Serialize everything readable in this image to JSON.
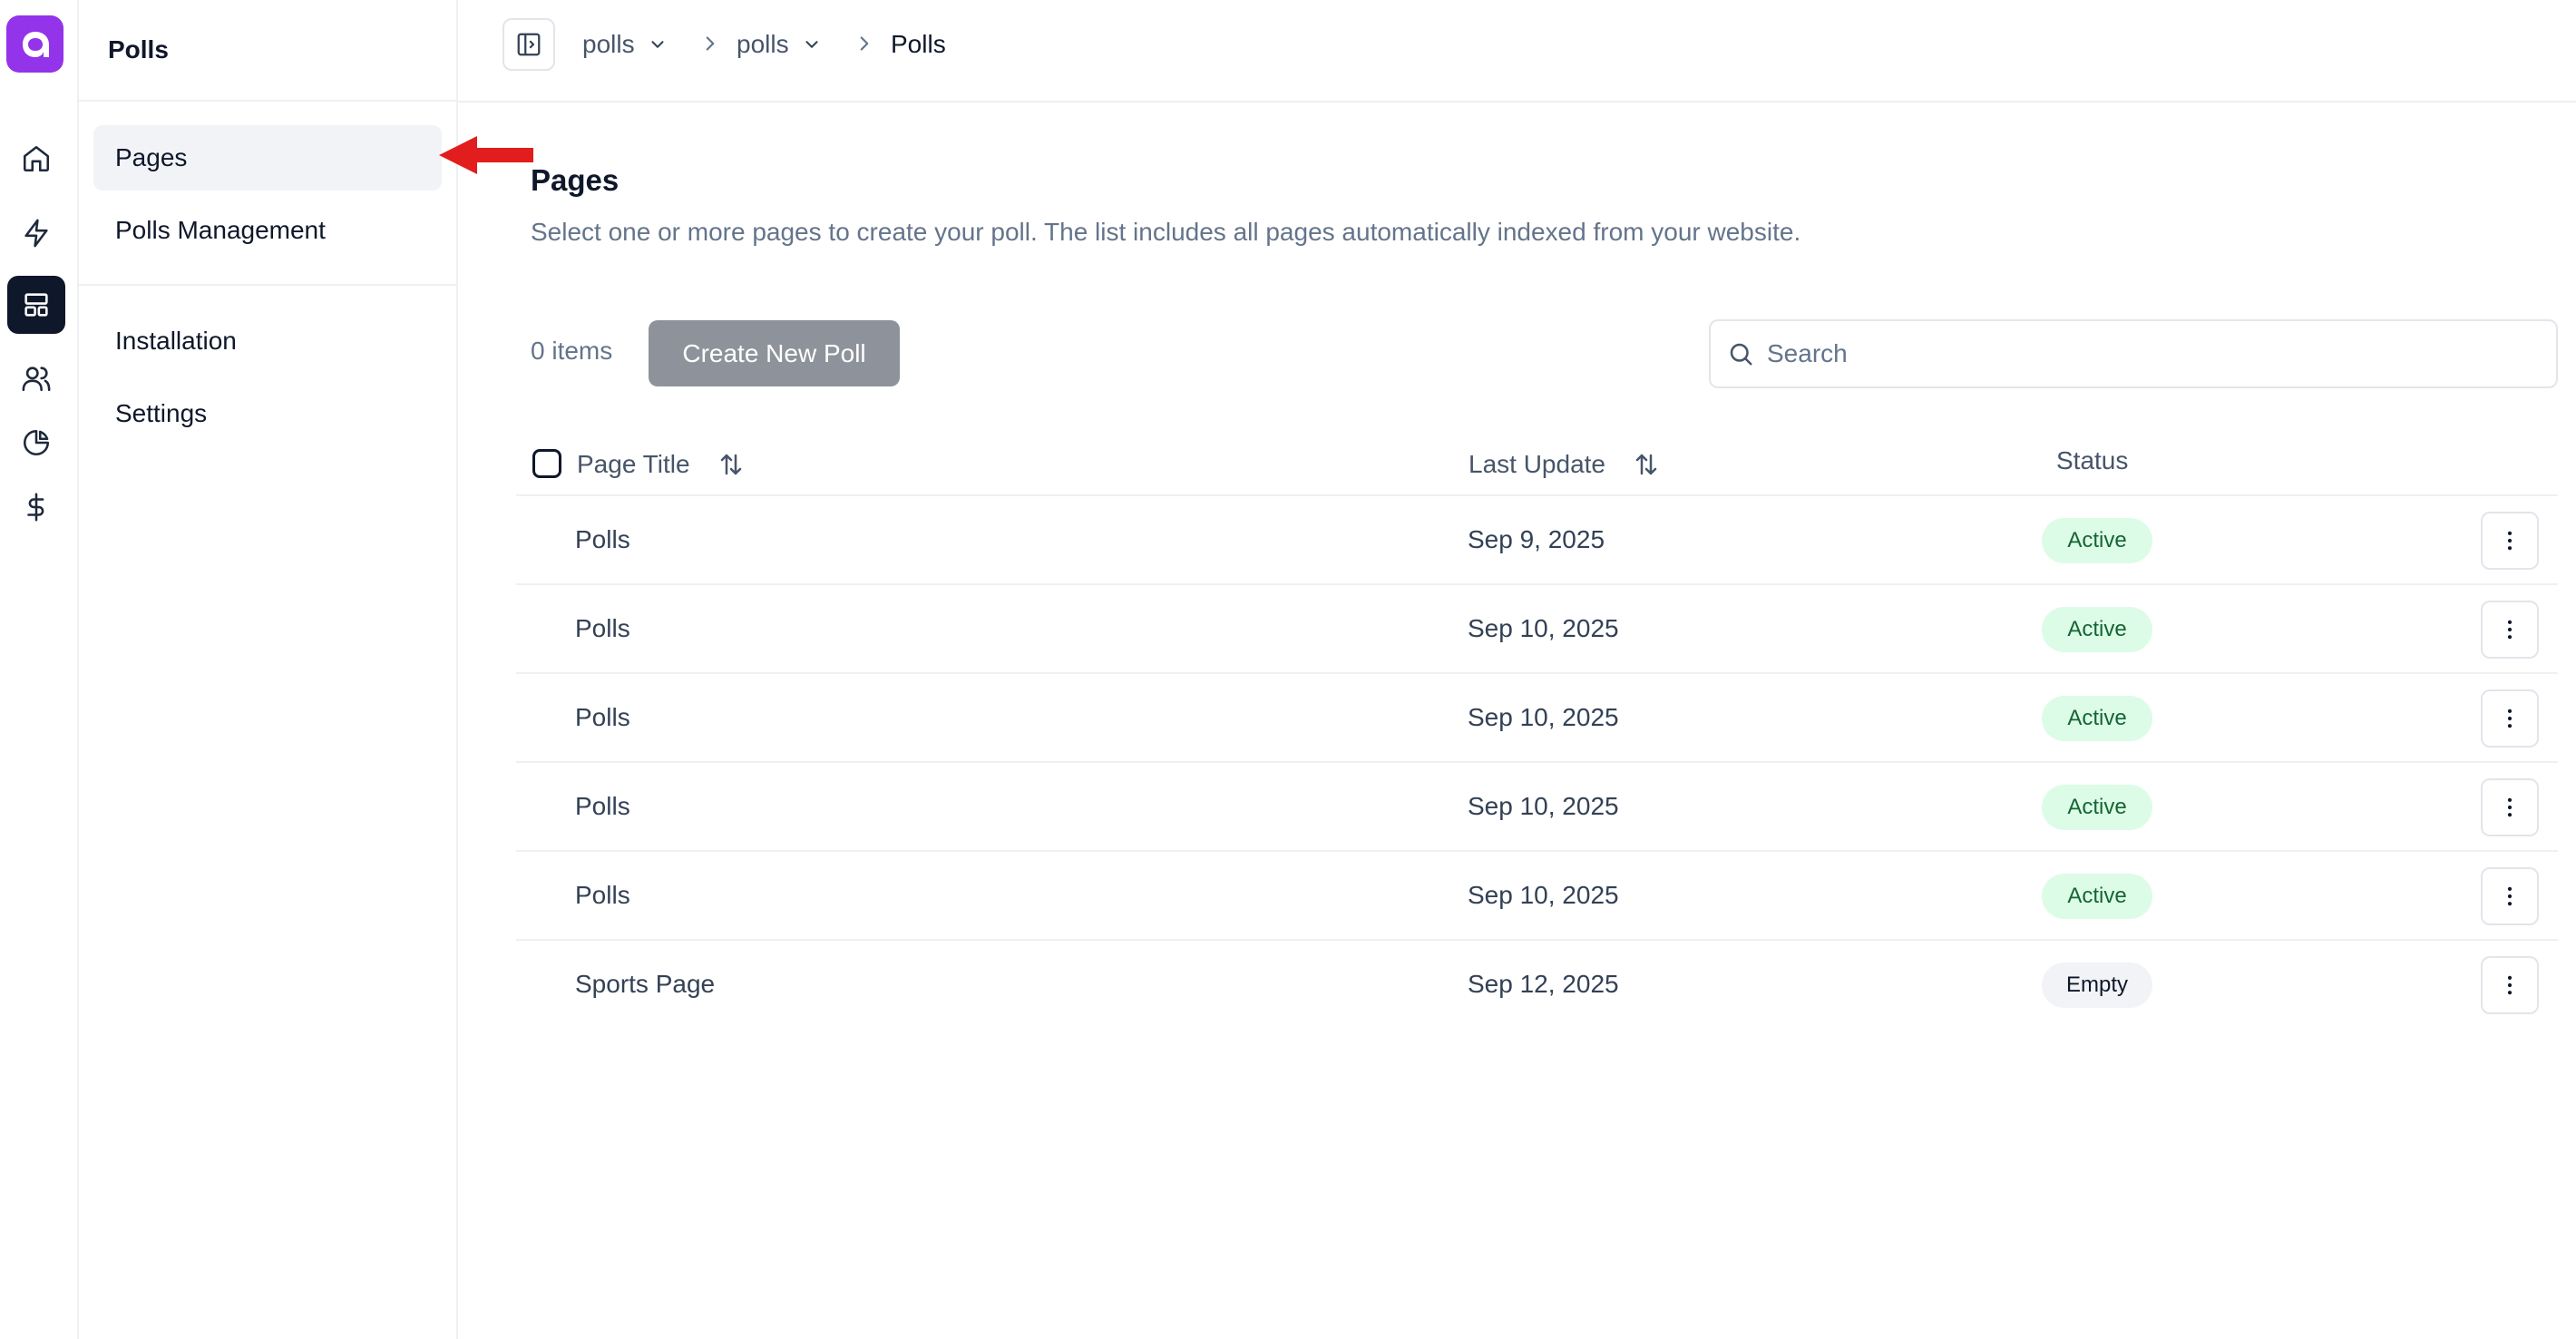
{
  "sidenav": {
    "title": "Polls",
    "items": [
      {
        "label": "Pages",
        "active": true
      },
      {
        "label": "Polls Management",
        "active": false
      },
      {
        "label": "Installation",
        "active": false
      },
      {
        "label": "Settings",
        "active": false
      }
    ]
  },
  "rail": {
    "icons": [
      "home-icon",
      "lightning-icon",
      "layout-icon",
      "users-icon",
      "pie-chart-icon",
      "dollar-icon"
    ],
    "active": "layout-icon",
    "logo_color": "#9333ea"
  },
  "breadcrumb": {
    "items": [
      "polls",
      "polls",
      "Polls"
    ]
  },
  "main": {
    "title": "Pages",
    "description": "Select one or more pages to create your poll. The list includes all pages automatically indexed from your website.",
    "items_count": "0 items",
    "create_button": "Create New Poll",
    "search_placeholder": "Search"
  },
  "table": {
    "columns": [
      "Page Title",
      "Last Update",
      "Status"
    ],
    "rows": [
      {
        "title": "Polls",
        "date": "Sep 9, 2025",
        "status": "Active"
      },
      {
        "title": "Polls",
        "date": "Sep 10, 2025",
        "status": "Active"
      },
      {
        "title": "Polls",
        "date": "Sep 10, 2025",
        "status": "Active"
      },
      {
        "title": "Polls",
        "date": "Sep 10, 2025",
        "status": "Active"
      },
      {
        "title": "Polls",
        "date": "Sep 10, 2025",
        "status": "Active"
      },
      {
        "title": "Sports Page",
        "date": "Sep 12, 2025",
        "status": "Empty"
      }
    ]
  },
  "colors": {
    "accent": "#9333ea",
    "active_badge_bg": "#dcfce7",
    "active_badge_text": "#166534",
    "annotation_arrow": "#e11d1d"
  }
}
